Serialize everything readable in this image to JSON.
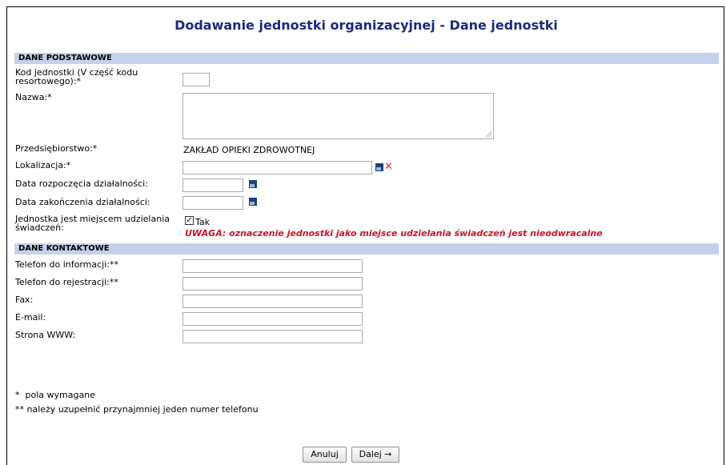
{
  "page": {
    "title": "Dodawanie jednostki organizacyjnej - Dane jednostki"
  },
  "basic": {
    "header": "DANE PODSTAWOWE",
    "kod_label": "Kod jednostki (V część kodu resortowego):*",
    "kod_value": "",
    "nazwa_label": "Nazwa:*",
    "nazwa_value": "",
    "przedsiebiorstwo_label": "Przedsiębiorstwo:*",
    "przedsiebiorstwo_value": "ZAKŁAD OPIEKI ZDROWOTNEJ",
    "lokalizacja_label": "Lokalizacja:*",
    "lokalizacja_value": "",
    "data_rozp_label": "Data rozpoczęcia działalności:",
    "data_rozp_value": "",
    "data_zak_label": "Data zakończenia działalności:",
    "data_zak_value": "",
    "miejsce_label": "Jednostka jest miejscem udzielania świadczeń:",
    "miejsce_checked": true,
    "miejsce_option": "Tak",
    "warning": "UWAGA: oznaczenie jednostki jako miejsce udzielania świadczeń jest nieodwracalne"
  },
  "contact": {
    "header": "DANE KONTAKTOWE",
    "tel_info_label": "Telefon do informacji:**",
    "tel_info_value": "",
    "tel_rej_label": "Telefon do rejestracji:**",
    "tel_rej_value": "",
    "fax_label": "Fax:",
    "fax_value": "",
    "email_label": "E-mail:",
    "email_value": "",
    "www_label": "Strona WWW:",
    "www_value": ""
  },
  "notes": {
    "required": "*  pola wymagane",
    "phone": "** należy uzupełnić przynajmniej jeden numer telefonu"
  },
  "buttons": {
    "cancel": "Anuluj",
    "next": "Dalej →"
  },
  "icons": {
    "calendar": "calendar-icon",
    "clear": "clear-icon",
    "lookup": "lookup-icon"
  },
  "colors": {
    "title": "#1a2a80",
    "section_bg": "#c5d1ea",
    "warning": "#c8142b"
  }
}
